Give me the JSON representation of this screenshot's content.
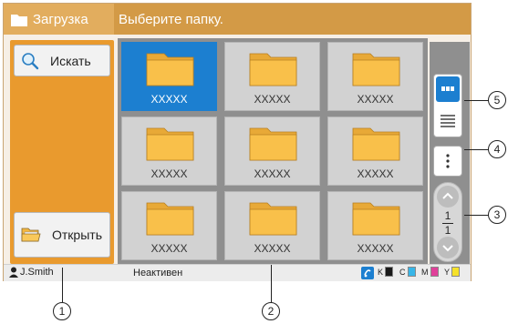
{
  "title": {
    "section": "Загрузка",
    "prompt": "Выберите папку."
  },
  "left_panel": {
    "search_label": "Искать",
    "open_label": "Открыть"
  },
  "folders": [
    {
      "label": "XXXXX",
      "selected": true
    },
    {
      "label": "XXXXX",
      "selected": false
    },
    {
      "label": "XXXXX",
      "selected": false
    },
    {
      "label": "XXXXX",
      "selected": false
    },
    {
      "label": "XXXXX",
      "selected": false
    },
    {
      "label": "XXXXX",
      "selected": false
    },
    {
      "label": "XXXXX",
      "selected": false
    },
    {
      "label": "XXXXX",
      "selected": false
    },
    {
      "label": "XXXXX",
      "selected": false
    }
  ],
  "pager": {
    "current": "1",
    "total": "1"
  },
  "status": {
    "user": "J.Smith",
    "state": "Неактивен",
    "inks": [
      {
        "label": "K",
        "color": "#1a1a1a"
      },
      {
        "label": "C",
        "color": "#38b6e8"
      },
      {
        "label": "M",
        "color": "#e0409a"
      },
      {
        "label": "Y",
        "color": "#f5e12a"
      }
    ]
  },
  "callouts": {
    "c1": "1",
    "c2": "2",
    "c3": "3",
    "c4": "4",
    "c5": "5"
  },
  "colors": {
    "title_bar": "#d39a46",
    "accent_blue": "#1c7fd0",
    "panel_orange": "#e99a2e",
    "folder_yellow": "#f9c04a"
  }
}
